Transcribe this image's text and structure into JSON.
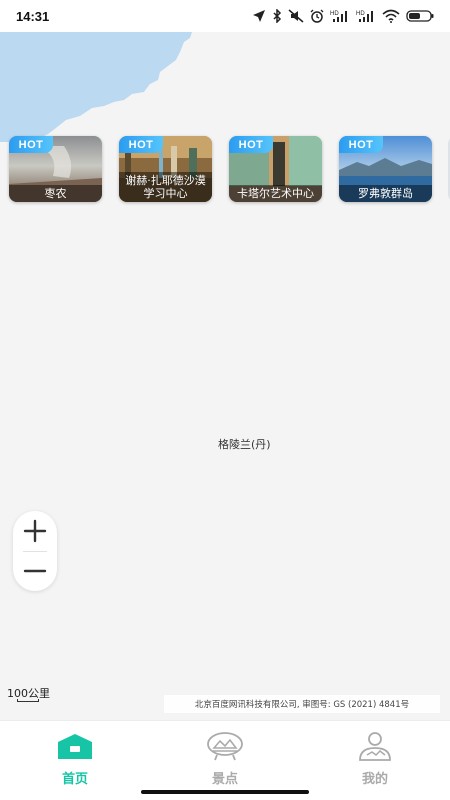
{
  "status_bar": {
    "time": "14:31",
    "icons": [
      "location-icon",
      "bluetooth-icon",
      "mute-icon",
      "alarm-icon",
      "hd-signal-icon",
      "hd-signal-icon",
      "wifi-icon",
      "battery-icon"
    ],
    "signal_tag": "HD"
  },
  "scenic_cards": [
    {
      "badge": "HOT",
      "name": "枣农"
    },
    {
      "badge": "HOT",
      "name": "谢赫·扎耶德沙漠学习中心"
    },
    {
      "badge": "HOT",
      "name": "卡塔尔艺术中心"
    },
    {
      "badge": "HOT",
      "name": "罗弗敦群岛"
    }
  ],
  "map": {
    "place_label": "格陵兰(丹)",
    "scale_label": "100公里",
    "copyright": "北京百度网讯科技有限公司, 审图号: GS (2021) 4841号",
    "water_color": "#bcd9f2",
    "land_color": "#f4f4f4"
  },
  "zoom": {
    "in_icon": "plus-icon",
    "out_icon": "minus-icon"
  },
  "tabs": [
    {
      "label": "首页",
      "icon": "home-icon",
      "active": true
    },
    {
      "label": "景点",
      "icon": "landscape-icon",
      "active": false
    },
    {
      "label": "我的",
      "icon": "profile-icon",
      "active": false
    }
  ],
  "colors": {
    "accent": "#17c4a6",
    "inactive": "#aaaaaa",
    "hot_badge": "#2c9cf0"
  }
}
